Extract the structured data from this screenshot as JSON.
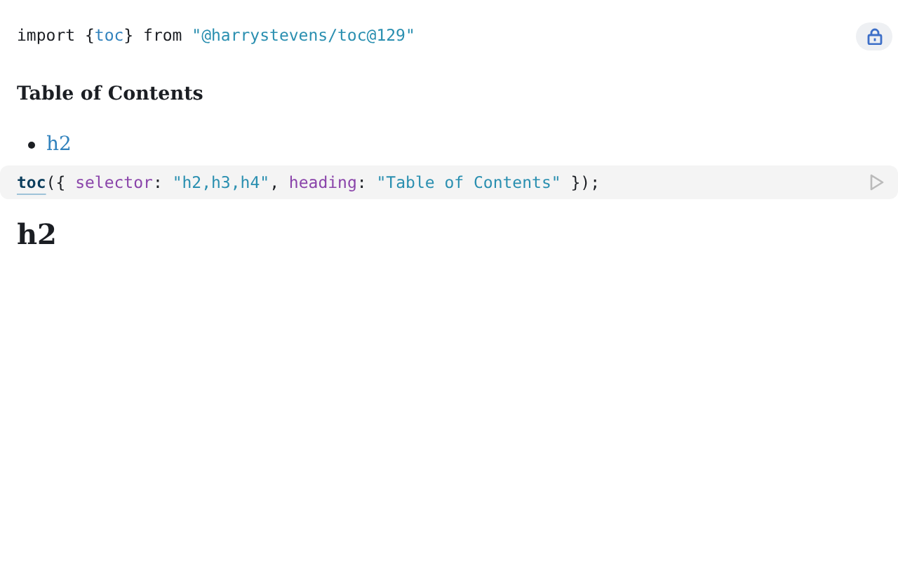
{
  "cells": [
    {
      "kind": "code",
      "pinned": false,
      "tokens": [
        {
          "text": "import {",
          "kind": "plain"
        },
        {
          "text": "toc",
          "kind": "variable"
        },
        {
          "text": "} from ",
          "kind": "plain"
        },
        {
          "text": "\"@harrystevens/toc@129\"",
          "kind": "string"
        }
      ]
    },
    {
      "kind": "toc",
      "heading": "Table of Contents",
      "items": [
        "h2"
      ]
    },
    {
      "kind": "code",
      "pinned": true,
      "tokens": [
        {
          "text": "toc",
          "kind": "definition"
        },
        {
          "text": "({ ",
          "kind": "plain"
        },
        {
          "text": "selector",
          "kind": "property"
        },
        {
          "text": ": ",
          "kind": "plain"
        },
        {
          "text": "\"h2,h3,h4\"",
          "kind": "string"
        },
        {
          "text": ", ",
          "kind": "plain"
        },
        {
          "text": "heading",
          "kind": "property"
        },
        {
          "text": ": ",
          "kind": "plain"
        },
        {
          "text": "\"Table of Contents\"",
          "kind": "string"
        },
        {
          "text": " });",
          "kind": "plain"
        }
      ]
    },
    {
      "kind": "heading",
      "text": "h2"
    }
  ]
}
